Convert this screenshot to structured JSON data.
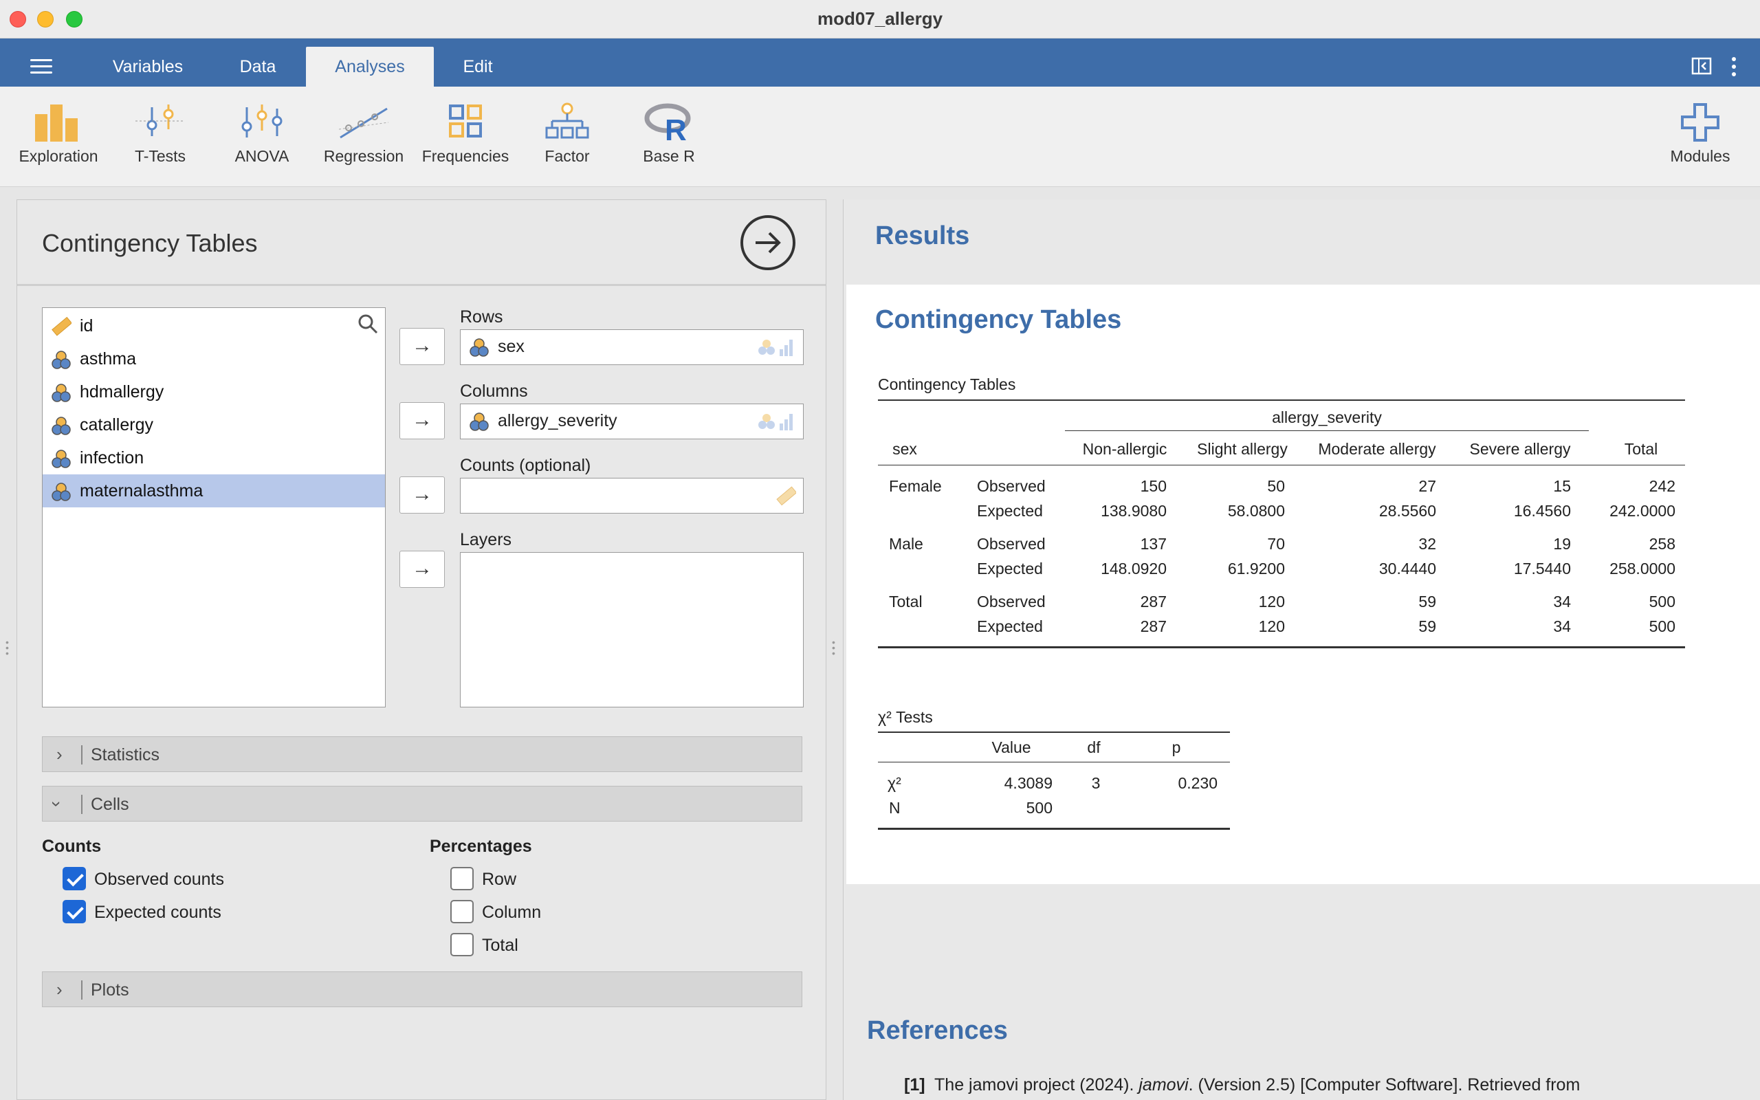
{
  "window": {
    "title": "mod07_allergy"
  },
  "menu": {
    "tabs": [
      "Variables",
      "Data",
      "Analyses",
      "Edit"
    ],
    "active": "Analyses"
  },
  "toolbar": {
    "exploration": "Exploration",
    "ttests": "T-Tests",
    "anova": "ANOVA",
    "regression": "Regression",
    "frequencies": "Frequencies",
    "factor": "Factor",
    "baser": "Base R",
    "modules": "Modules"
  },
  "analysis": {
    "title": "Contingency Tables",
    "variables": [
      "id",
      "asthma",
      "hdmallergy",
      "catallergy",
      "infection",
      "maternalasthma"
    ],
    "selected_variable": "maternalasthma",
    "rows_label": "Rows",
    "rows_value": "sex",
    "columns_label": "Columns",
    "columns_value": "allergy_severity",
    "counts_label": "Counts (optional)",
    "layers_label": "Layers",
    "sections": {
      "statistics": "Statistics",
      "cells": "Cells",
      "plots": "Plots"
    },
    "cells": {
      "counts_title": "Counts",
      "observed": "Observed counts",
      "expected": "Expected counts",
      "percentages_title": "Percentages",
      "row": "Row",
      "column": "Column",
      "total": "Total"
    }
  },
  "results": {
    "heading": "Results",
    "ct_heading": "Contingency Tables",
    "table_caption": "Contingency Tables",
    "col_group": "allergy_severity",
    "row_header": "sex",
    "columns": [
      "Non-allergic",
      "Slight allergy",
      "Moderate allergy",
      "Severe allergy",
      "Total"
    ],
    "rows": [
      {
        "group": "Female",
        "obs_label": "Observed",
        "exp_label": "Expected",
        "observed": [
          "150",
          "50",
          "27",
          "15",
          "242"
        ],
        "expected": [
          "138.9080",
          "58.0800",
          "28.5560",
          "16.4560",
          "242.0000"
        ]
      },
      {
        "group": "Male",
        "obs_label": "Observed",
        "exp_label": "Expected",
        "observed": [
          "137",
          "70",
          "32",
          "19",
          "258"
        ],
        "expected": [
          "148.0920",
          "61.9200",
          "30.4440",
          "17.5440",
          "258.0000"
        ]
      },
      {
        "group": "Total",
        "obs_label": "Observed",
        "exp_label": "Expected",
        "observed": [
          "287",
          "120",
          "59",
          "34",
          "500"
        ],
        "expected": [
          "287",
          "120",
          "59",
          "34",
          "500"
        ]
      }
    ],
    "chi": {
      "caption": "χ² Tests",
      "headers": [
        "Value",
        "df",
        "p"
      ],
      "chi_label": "χ²",
      "chi_value": "4.3089",
      "chi_df": "3",
      "chi_p": "0.230",
      "n_label": "N",
      "n_value": "500"
    },
    "references_heading": "References",
    "ref1_num": "[1]",
    "ref1_pre": "The jamovi project (2024). ",
    "ref1_italic": "jamovi",
    "ref1_post": ". (Version 2.5) [Computer Software]. Retrieved from"
  },
  "colors": {
    "accent": "#3e6da9",
    "selected": "#b7c8ea",
    "checkbox": "#1d67d6"
  }
}
